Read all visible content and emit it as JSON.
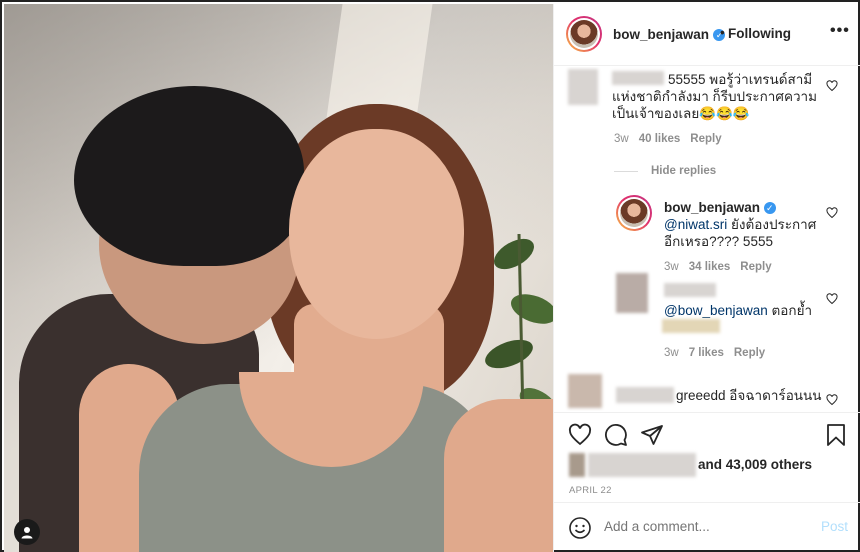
{
  "header": {
    "username": "bow_benjawan",
    "separator": "•",
    "follow_status": "Following",
    "more_icon": "more-horizontal-icon",
    "verified_icon": "verified-badge-icon"
  },
  "comments": [
    {
      "text_line1": "55555 พอรู้ว่าเทรนด์สามี",
      "text_line2": "แห่งชาติกำลังมา ก็รีบประกาศความ",
      "text_line3": "เป็นเจ้าของเลย😂😂😂",
      "time": "3w",
      "likes": "40 likes",
      "reply": "Reply"
    }
  ],
  "hide_replies": "Hide replies",
  "replies": [
    {
      "username": "bow_benjawan",
      "mention": "@niwat.sri",
      "text_line1": " ยังต้องประกาศ",
      "text_line2": "อีกเหรอ???? 5555",
      "time": "3w",
      "likes": "34 likes",
      "reply": "Reply"
    },
    {
      "mention": "@bow_benjawan",
      "text": " ตอกย้ำ",
      "time": "3w",
      "likes": "7 likes",
      "reply": "Reply"
    }
  ],
  "last_comment": {
    "text": "greeedd อีจฉาดาร์อนนน"
  },
  "actions": {
    "like_icon": "heart-icon",
    "comment_icon": "comment-icon",
    "share_icon": "send-icon",
    "save_icon": "bookmark-icon",
    "likes_summary": "and 43,009 others",
    "date": "APRIL 22"
  },
  "add_comment": {
    "placeholder": "Add a comment...",
    "post_label": "Post",
    "emoji_icon": "emoji-icon"
  },
  "photo": {
    "user_tag_icon": "user-tag-icon"
  },
  "colors": {
    "verified": "#3897f0",
    "post_disabled": "#b2dffc",
    "secondary_text": "#8e8e8e",
    "mention": "#003569"
  }
}
